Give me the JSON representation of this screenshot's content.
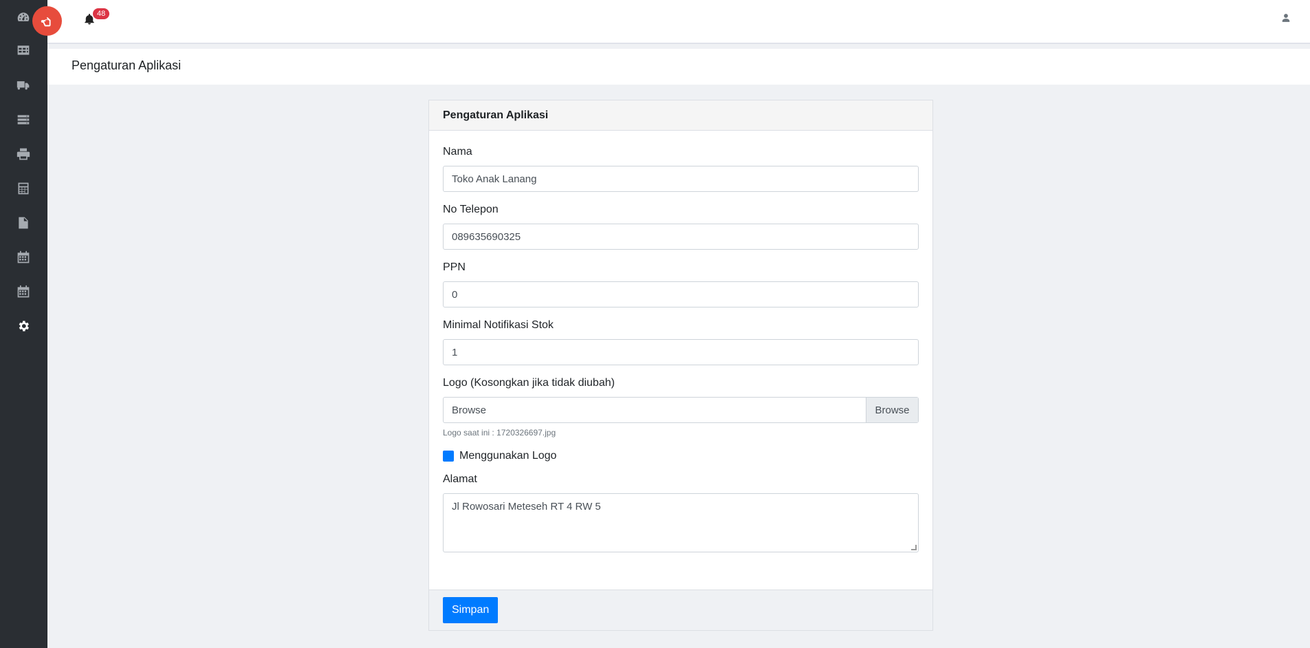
{
  "topbar": {
    "notification_count": "48"
  },
  "page": {
    "title": "Pengaturan Aplikasi"
  },
  "card": {
    "title": "Pengaturan Aplikasi",
    "fields": {
      "nama": {
        "label": "Nama",
        "value": "Toko Anak Lanang"
      },
      "telepon": {
        "label": "No Telepon",
        "value": "089635690325"
      },
      "ppn": {
        "label": "PPN",
        "value": "0"
      },
      "min_notif": {
        "label": "Minimal Notifikasi Stok",
        "value": "1"
      },
      "logo": {
        "label": "Logo (Kosongkan jika tidak diubah)",
        "placeholder": "Browse",
        "button": "Browse",
        "help": "Logo saat ini : 1720326697.jpg"
      },
      "use_logo": {
        "label": "Menggunakan Logo",
        "checked": true
      },
      "alamat": {
        "label": "Alamat",
        "value": "Jl Rowosari Meteseh RT 4 RW 5"
      }
    },
    "save_label": "Simpan"
  },
  "sidebar": {
    "items": [
      {
        "icon": "dashboard-icon"
      },
      {
        "icon": "table-icon"
      },
      {
        "icon": "truck-icon"
      },
      {
        "icon": "server-icon"
      },
      {
        "icon": "print-icon"
      },
      {
        "icon": "calculator-icon"
      },
      {
        "icon": "file-icon"
      },
      {
        "icon": "calendar-icon"
      },
      {
        "icon": "calendar-icon"
      },
      {
        "icon": "gear-icon",
        "active": true
      }
    ]
  },
  "colors": {
    "sidebar": "#2a2e33",
    "accent": "#007bff",
    "fab": "#e74c3c",
    "badge": "#dc3545"
  }
}
